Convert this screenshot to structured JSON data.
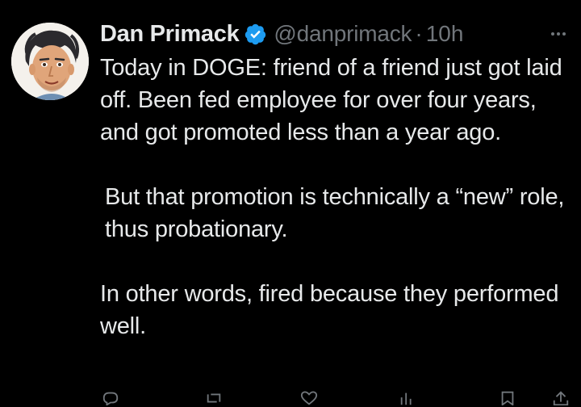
{
  "author": {
    "name": "Dan Primack",
    "handle": "@danprimack",
    "separator": "·",
    "time": "10h",
    "verified": true
  },
  "tweet": {
    "paragraphs": [
      "Today in DOGE: friend of a friend just got laid off. Been fed employee for over four years, and got promoted less than a year ago.",
      "But that promotion is technically a “new” role, thus probationary.",
      "In other words, fired because they performed well."
    ]
  },
  "icons": {
    "avatar": "avatar-illustration",
    "verified": "verified-badge-icon",
    "more": "more-options-icon",
    "reply": "reply-icon",
    "retweet": "retweet-icon",
    "like": "like-icon",
    "views": "views-icon",
    "bookmark": "bookmark-icon",
    "share": "share-icon"
  },
  "colors": {
    "background": "#000000",
    "text": "#e7e9ea",
    "muted": "#71767b",
    "verified": "#1d9bf0"
  }
}
